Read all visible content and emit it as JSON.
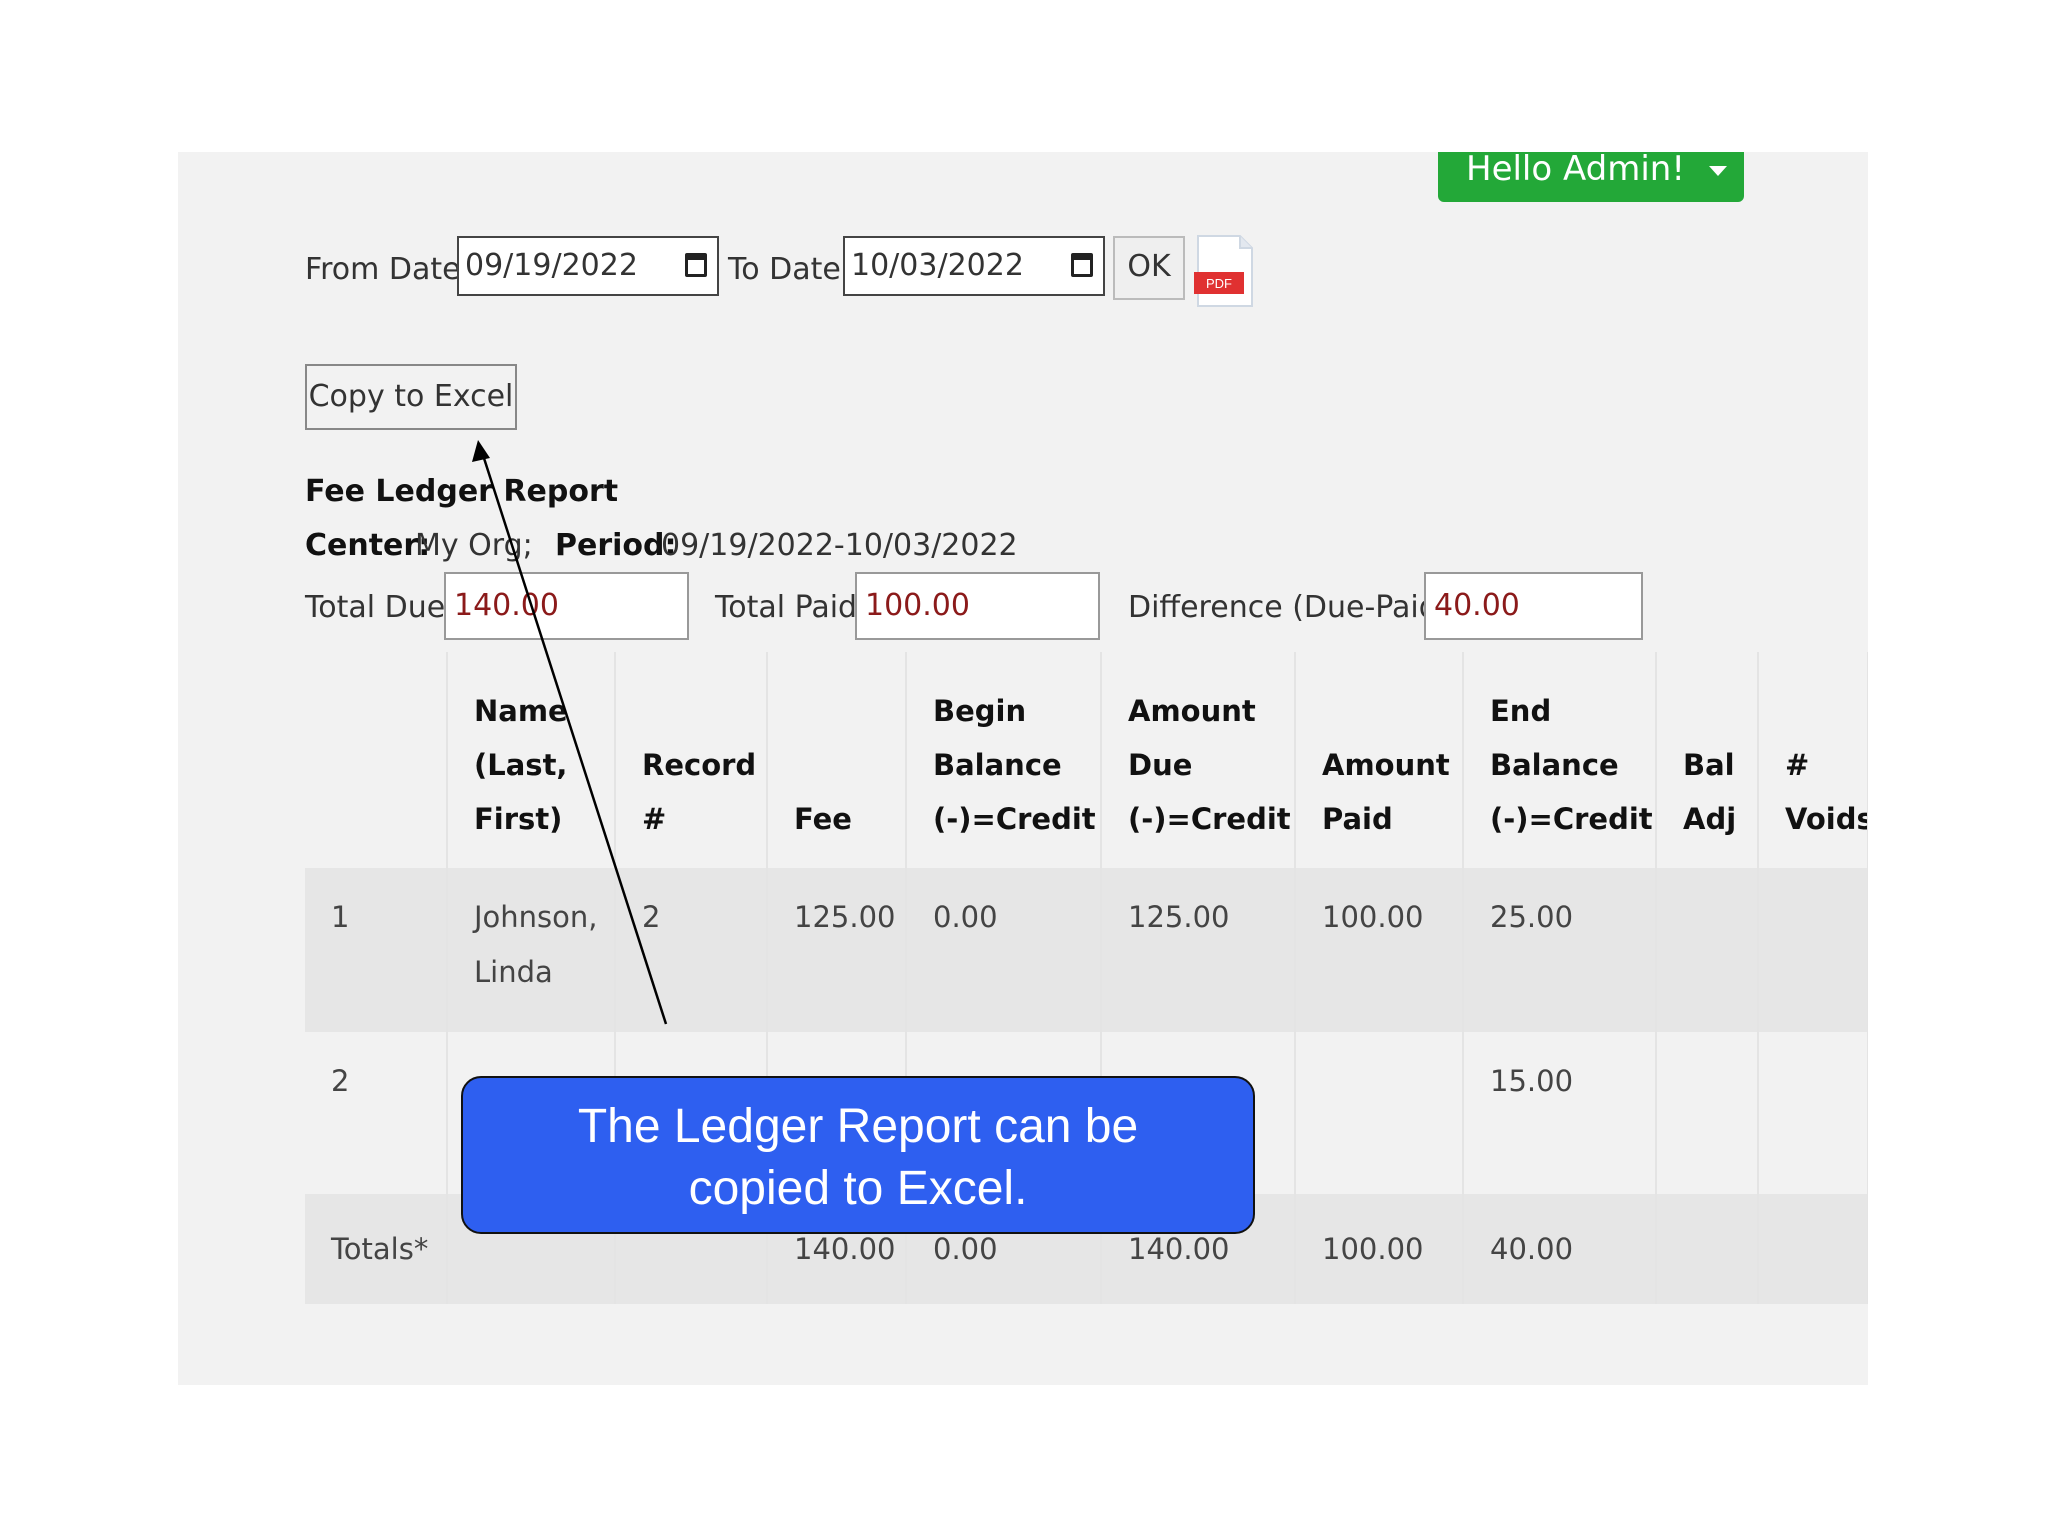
{
  "header": {
    "user_menu_label": "Hello Admin!"
  },
  "filters": {
    "from_label": "From Date:",
    "from_value": "09/19/2022",
    "to_label": "To Date:",
    "to_value": "10/03/2022",
    "ok_label": "OK",
    "pdf_badge": "PDF"
  },
  "actions": {
    "copy_excel_label": "Copy to Excel"
  },
  "report": {
    "title": "Fee Ledger Report",
    "center_label": "Center:",
    "center_value": "My Org;",
    "period_label": "Period:",
    "period_value": "09/19/2022-10/03/2022",
    "total_due_label": "Total Due:",
    "total_due_value": "140.00",
    "total_paid_label": "Total Paid:",
    "total_paid_value": "100.00",
    "difference_label": "Difference (Due-Paid):",
    "difference_value": "40.00"
  },
  "table": {
    "headers": [
      [
        ""
      ],
      [
        "Name",
        "(Last,",
        "First)"
      ],
      [
        "Record",
        "#"
      ],
      [
        "Fee"
      ],
      [
        "Begin",
        "Balance",
        "(-)=Credit"
      ],
      [
        "Amount",
        "Due",
        "(-)=Credit"
      ],
      [
        "Amount",
        "Paid"
      ],
      [
        "End",
        "Balance",
        "(-)=Credit"
      ],
      [
        "Bal",
        "Adj"
      ],
      [
        "#",
        "Voids"
      ]
    ],
    "rows": [
      {
        "num": "1",
        "name": [
          "Johnson,",
          "Linda"
        ],
        "record": "2",
        "fee": "125.00",
        "begin": "0.00",
        "due": "125.00",
        "paid": "100.00",
        "end": "25.00",
        "bal_adj": "",
        "voids": ""
      },
      {
        "num": "2",
        "name": [
          ""
        ],
        "record": "",
        "fee": "",
        "begin": "",
        "due": "",
        "paid": "",
        "end": "15.00",
        "bal_adj": "",
        "voids": ""
      }
    ],
    "totals": {
      "label": "Totals*",
      "fee": "140.00",
      "begin": "0.00",
      "due": "140.00",
      "paid": "100.00",
      "end": "40.00"
    }
  },
  "callout": {
    "line1": "The Ledger Report can be",
    "line2": "copied to Excel."
  },
  "colors": {
    "user_menu": "#23a838",
    "callout": "#2e5ff0",
    "value_text": "#8b1a1a"
  }
}
